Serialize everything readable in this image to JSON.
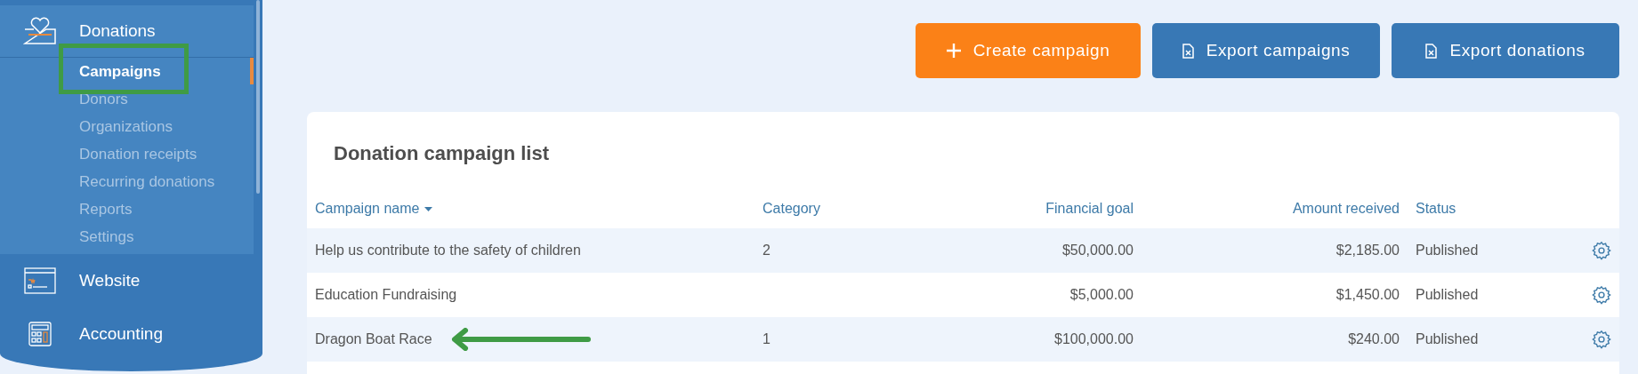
{
  "sidebar": {
    "sections": [
      {
        "label": "Donations",
        "expanded": true,
        "children": [
          {
            "label": "Campaigns",
            "selected": true
          },
          {
            "label": "Donors",
            "selected": false
          },
          {
            "label": "Organizations",
            "selected": false
          },
          {
            "label": "Donation receipts",
            "selected": false
          },
          {
            "label": "Recurring donations",
            "selected": false
          },
          {
            "label": "Reports",
            "selected": false
          },
          {
            "label": "Settings",
            "selected": false
          }
        ]
      },
      {
        "label": "Website",
        "expanded": false
      },
      {
        "label": "Accounting",
        "expanded": false
      }
    ]
  },
  "toolbar": {
    "buttons": [
      {
        "label": "Create campaign",
        "kind": "primary"
      },
      {
        "label": "Export campaigns",
        "kind": "secondary"
      },
      {
        "label": "Export donations",
        "kind": "secondary"
      }
    ]
  },
  "table": {
    "title": "Donation campaign list",
    "columns": [
      {
        "label": "Campaign name",
        "sorted": true
      },
      {
        "label": "Category",
        "sorted": false
      },
      {
        "label": "Financial goal",
        "sorted": false
      },
      {
        "label": "Amount received",
        "sorted": false
      },
      {
        "label": "Status",
        "sorted": false
      }
    ],
    "rows": [
      {
        "cells": [
          "Help us contribute to the safety of children",
          "2",
          "$50,000.00",
          "$2,185.00",
          "Published"
        ]
      },
      {
        "cells": [
          "Education Fundraising",
          "",
          "$5,000.00",
          "$1,450.00",
          "Published"
        ]
      },
      {
        "cells": [
          "Dragon Boat Race",
          "1",
          "$100,000.00",
          "$240.00",
          "Published"
        ]
      }
    ]
  },
  "annotations": [
    {
      "kind": "box"
    },
    {
      "kind": "arrow"
    }
  ]
}
